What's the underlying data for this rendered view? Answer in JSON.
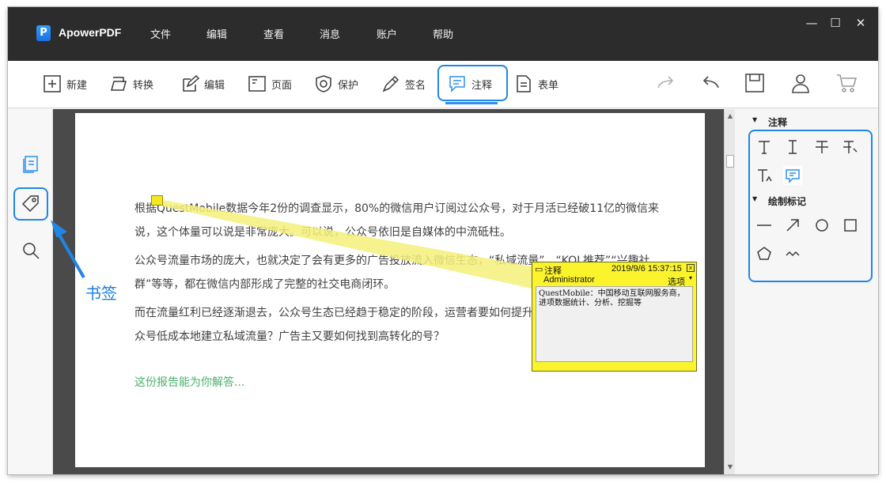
{
  "app": {
    "name": "ApowerPDF",
    "logo_letter": "P"
  },
  "menu": [
    "文件",
    "编辑",
    "查看",
    "消息",
    "账户",
    "帮助"
  ],
  "window_controls": {
    "minimize": "—",
    "maximize": "☐",
    "close": "✕"
  },
  "toolbar": {
    "new_label": "新建",
    "convert_label": "转换",
    "edit_label": "编辑",
    "page_label": "页面",
    "protect_label": "保护",
    "sign_label": "签名",
    "annotate_label": "注释",
    "form_label": "表单",
    "active_tool": "注释"
  },
  "sidebar": {
    "bookmark_callout": "书签"
  },
  "document": {
    "paragraphs": [
      "根据QuestMobile数据今年2份的调查显示，80%的微信用户订阅过公众号，对于月活已经破11亿的微信来说，这个体量可以说是非常庞大。可以说，公众号依旧是自媒体的中流砥柱。",
      "公众号流量市场的庞大，也就决定了会有更多的广告投放流入微信生态，“私域流量”、“KOL推荐”“兴趣社群”等等，都在微信内部形成了完整的社交电商闭环。",
      "而在流量红利已经逐渐退去，公众号生态已经趋于稳定的阶段，运营者要如何提升广告转化，企业怎么借助公众号低成本地建立私域流量？广告主又要如何找到高转化的号？"
    ],
    "cta": "这份报告能为你解答..."
  },
  "note": {
    "label": "注释",
    "datetime": "2019/9/6 15:37:15",
    "close": "x",
    "author": "Administrator",
    "options": "选项",
    "options_arrow": "▾",
    "content": "QuestMobile：中国移动互联网服务商，进项数据统计、分析、挖掘等"
  },
  "right_panel": {
    "section_annotate": "注释",
    "section_draw": "绘制标记",
    "caret": "▼"
  },
  "colors": {
    "accent": "#1f86e8",
    "note_yellow": "#fbf42d",
    "cta_green": "#48b06a",
    "title_bar": "#2c2c2c"
  }
}
